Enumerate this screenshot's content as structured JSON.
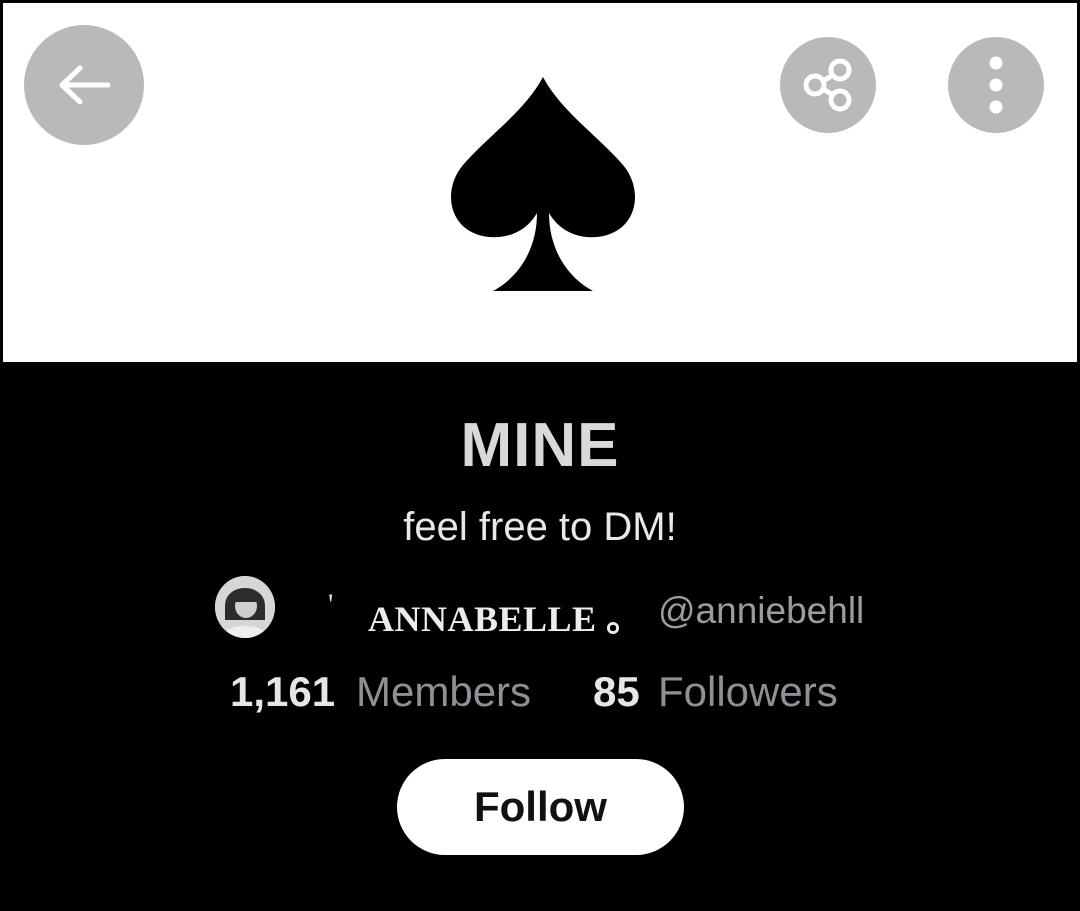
{
  "header": {
    "back_icon": "arrow-left-icon",
    "share_icon": "share-icon",
    "more_icon": "more-vertical-icon",
    "button_color": "#b8b9bb"
  },
  "banner": {
    "art_icon": "spade-icon",
    "background": "#ffffff"
  },
  "community": {
    "name": "MINE",
    "tagline": "feel free to DM!"
  },
  "owner": {
    "prefix": "'",
    "display_name": "ANNABELLE 。",
    "handle": "@anniebehll"
  },
  "stats": {
    "members_count": "1,161",
    "members_label": "Members",
    "followers_count": "85",
    "followers_label": "Followers"
  },
  "actions": {
    "follow_label": "Follow"
  }
}
